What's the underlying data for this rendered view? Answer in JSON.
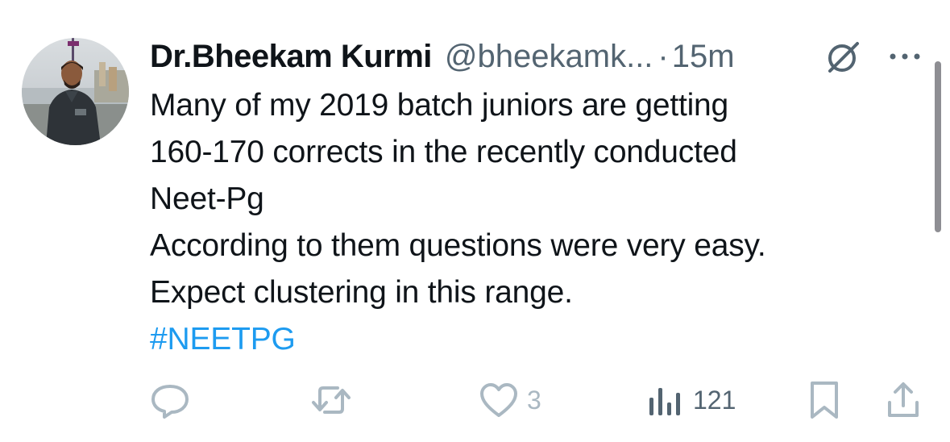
{
  "tweet": {
    "author_name": "Dr.Bheekam Kurmi",
    "handle": "@bheekamk...",
    "separator": "·",
    "time": "15m",
    "lines": [
      "Many of my 2019 batch juniors are getting",
      "160-170 corrects in the recently conducted",
      "Neet-Pg",
      "According to them questions were very easy.",
      "Expect clustering in this range."
    ],
    "hashtag": "#NEETPG"
  },
  "icons": {
    "avatar": "avatar-photo",
    "grok": "grok-icon",
    "more": "more-icon",
    "reply": "reply-icon",
    "retweet": "retweet-icon",
    "like": "heart-icon",
    "views": "views-icon",
    "bookmark": "bookmark-icon",
    "share": "share-icon"
  },
  "actions": {
    "like_count": "3",
    "views_count": "121"
  },
  "colors": {
    "text": "#0f1419",
    "secondary": "#536471",
    "hashtag": "#1d9bf0",
    "muted_icon": "#aab8c2"
  }
}
